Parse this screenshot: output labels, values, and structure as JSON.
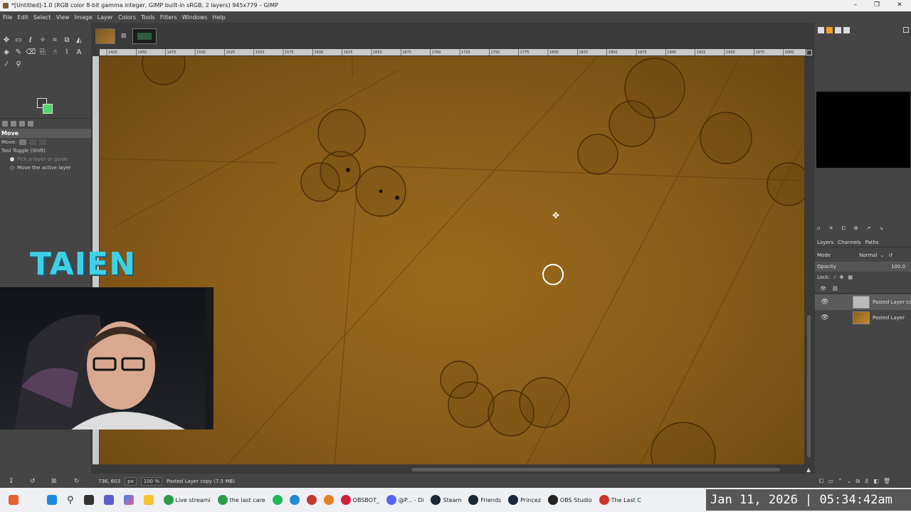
{
  "window": {
    "title": "*[Untitled]-1.0 (RGB color 8-bit gamma integer, GIMP built-in sRGB, 2 layers) 945x779 – GIMP",
    "minimize": "–",
    "maximize": "❐",
    "close": "✕"
  },
  "menu": [
    "File",
    "Edit",
    "Select",
    "View",
    "Image",
    "Layer",
    "Colors",
    "Tools",
    "Filters",
    "Windows",
    "Help"
  ],
  "tool_options": {
    "title": "Move",
    "move_label": "Move:",
    "toggle_label": "Tool Toggle  (Shift)",
    "option1": "Pick a layer or guide",
    "option2": "Move the active layer"
  },
  "colors": {
    "foreground": "#3c3c3c",
    "background": "#4cd964"
  },
  "rulers": {
    "h_ticks": [
      "1425",
      "1450",
      "1475",
      "1500",
      "1525",
      "1550",
      "1575",
      "1600",
      "1625",
      "1650",
      "1675",
      "1700",
      "1725",
      "1750",
      "1775",
      "1800",
      "1825",
      "1850",
      "1875",
      "1900",
      "1925",
      "1950",
      "1975",
      "2000"
    ]
  },
  "status": {
    "coords": "736, 603",
    "unit": "px",
    "zoom": "100 %",
    "message": "Pasted Layer copy (7.5 MB)"
  },
  "layers_panel": {
    "tabs": [
      "Layers",
      "Channels",
      "Paths"
    ],
    "mode_label": "Mode",
    "mode_value": "Normal",
    "opacity_label": "Opacity",
    "opacity_value": "100.0",
    "lock_label": "Lock:",
    "layers": [
      {
        "name": "Pasted Layer copy",
        "selected": true
      },
      {
        "name": "Pasted Layer",
        "selected": false
      }
    ]
  },
  "overlay": {
    "logo": "TAIEN",
    "clock": "Jan 11, 2026 | 05:34:42am"
  },
  "taskbar": {
    "items": [
      {
        "label": "Live streami",
        "icon": "chrome-icon",
        "color": "#2a9d4a"
      },
      {
        "label": "the last care",
        "icon": "chrome-icon",
        "color": "#2a9d4a"
      },
      {
        "label": "",
        "icon": "spotify-icon",
        "color": "#1db954"
      },
      {
        "label": "",
        "icon": "edge-icon",
        "color": "#1f8ad6"
      },
      {
        "label": "",
        "icon": "app-icon",
        "color": "#c0392b"
      },
      {
        "label": "",
        "icon": "app-icon",
        "color": "#e67e22"
      },
      {
        "label": "OBSBOT_",
        "icon": "obsbot-icon",
        "color": "#d0203a"
      },
      {
        "label": "@P... - Di",
        "icon": "discord-icon",
        "color": "#5865f2"
      },
      {
        "label": "Steam",
        "icon": "steam-icon",
        "color": "#1b2838"
      },
      {
        "label": "Friends",
        "icon": "steam-icon",
        "color": "#1b2838"
      },
      {
        "label": "Princez",
        "icon": "steam-icon",
        "color": "#1b2838"
      },
      {
        "label": "OBS Studio",
        "icon": "obs-icon",
        "color": "#222222"
      },
      {
        "label": "The Last C",
        "icon": "game-icon",
        "color": "#d0312d"
      }
    ]
  }
}
